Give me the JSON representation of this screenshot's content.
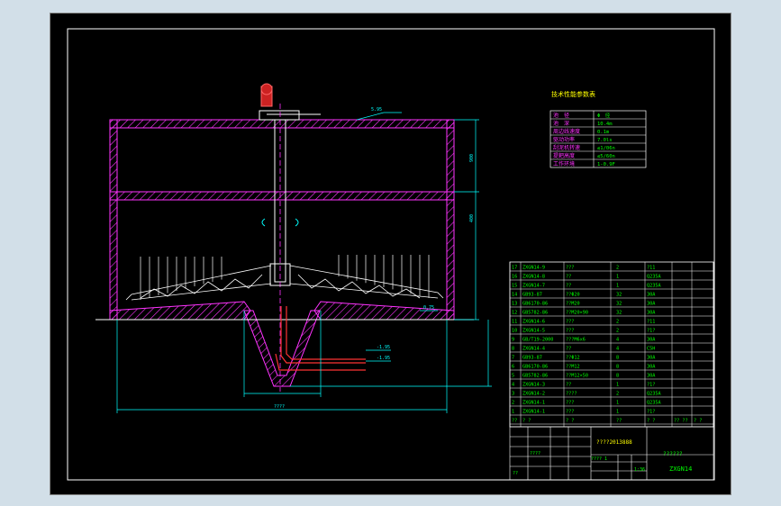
{
  "drawing": {
    "level_label": "5.95",
    "dim_right_upper": "900",
    "dim_right_lower": "400",
    "dim_bottom": "????",
    "pipe_label_1": "-1.95",
    "pipe_label_2": "-1.95",
    "bottom_level": "0.75"
  },
  "spec_table": {
    "title": "技术性能参数表",
    "rows": [
      {
        "name": "池　径",
        "value": "Φ　径"
      },
      {
        "name": "池　深",
        "value": "10.4m"
      },
      {
        "name": "周边线速度",
        "value": "0.1m"
      },
      {
        "name": "驱动功率",
        "value": "7.0ls"
      },
      {
        "name": "刮泥机转速",
        "value": "≤1/06n"
      },
      {
        "name": "提耙高度",
        "value": "≤5/60n"
      },
      {
        "name": "工作环境",
        "value": "1-0.9F"
      }
    ]
  },
  "parts": [
    {
      "no": "17",
      "code": "ZXGN14-9",
      "name": "???",
      "qty": "2",
      "mat": "?11"
    },
    {
      "no": "16",
      "code": "ZXGN14-8",
      "name": "??",
      "qty": "1",
      "mat": "Q235A"
    },
    {
      "no": "15",
      "code": "ZXGN14-7",
      "name": "??",
      "qty": "1",
      "mat": "Q235A"
    },
    {
      "no": "14",
      "code": "GB93-87",
      "name": "??Φ20",
      "qty": "32",
      "mat": "30A"
    },
    {
      "no": "13",
      "code": "GB6170-86",
      "name": "??M20",
      "qty": "32",
      "mat": "30A"
    },
    {
      "no": "12",
      "code": "GB5782-86",
      "name": "??M20×90",
      "qty": "32",
      "mat": "30A"
    },
    {
      "no": "11",
      "code": "ZXGN14-6",
      "name": "???",
      "qty": "2",
      "mat": "?11"
    },
    {
      "no": "10",
      "code": "ZXGN14-5",
      "name": "???",
      "qty": "2",
      "mat": "?1?"
    },
    {
      "no": "9",
      "code": "GB/T19-2000",
      "name": "???M6x6",
      "qty": "4",
      "mat": "30A"
    },
    {
      "no": "8",
      "code": "ZXGN14-4",
      "name": "??",
      "qty": "4",
      "mat": "C5H"
    },
    {
      "no": "7",
      "code": "GB93-87",
      "name": "??Φ12",
      "qty": "8",
      "mat": "30A"
    },
    {
      "no": "6",
      "code": "GB6170-86",
      "name": "??M12",
      "qty": "8",
      "mat": "30A"
    },
    {
      "no": "5",
      "code": "GB5782-86",
      "name": "??M12×50",
      "qty": "8",
      "mat": "30A"
    },
    {
      "no": "4",
      "code": "ZXGN14-3",
      "name": "??",
      "qty": "1",
      "mat": "?1?"
    },
    {
      "no": "3",
      "code": "ZXGN14-2",
      "name": "????",
      "qty": "2",
      "mat": "Q235A"
    },
    {
      "no": "2",
      "code": "ZXGN14-1",
      "name": "???",
      "qty": "1",
      "mat": "Q235A"
    },
    {
      "no": "1",
      "code": "ZXGN14-1",
      "name": "???",
      "qty": "1",
      "mat": "?1?"
    }
  ],
  "parts_header": {
    "no": "??",
    "code": "? ?",
    "name": "? ?",
    "qty": "??",
    "mat": "? ?",
    "w1": "?? ??",
    "note": "? ?"
  },
  "title_block": {
    "project": "????2013888",
    "drawing_name": "??????",
    "drawing_no": "ZXGN14",
    "ratio": "1:36",
    "sheet": "???? 1",
    "small_1": "????",
    "small_2": "??"
  },
  "colors": {
    "frame": "#ffffff",
    "wall": "#ff33ff",
    "dim": "#00ffff",
    "structure": "#ffffff",
    "table_text": "#00ff00",
    "title": "#ffff00"
  }
}
